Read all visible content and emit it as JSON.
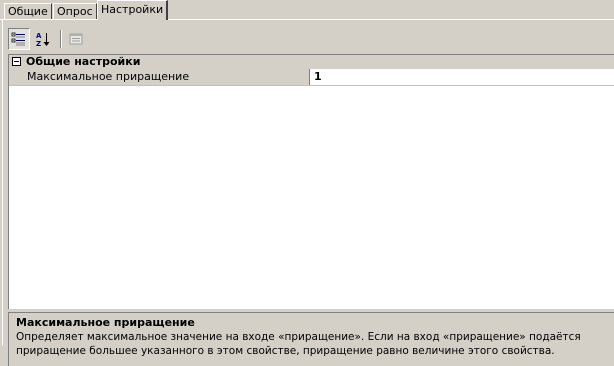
{
  "tabs": [
    {
      "label": "Общие",
      "active": false
    },
    {
      "label": "Опрос",
      "active": false
    },
    {
      "label": "Настройки",
      "active": true
    }
  ],
  "toolbar": {
    "buttons": [
      {
        "icon": "categorized-view-icon",
        "pressed": true
      },
      {
        "icon": "sort-alphabetical-icon",
        "pressed": false
      },
      {
        "icon": "property-pages-icon",
        "pressed": false,
        "disabled": true
      }
    ]
  },
  "grid": {
    "category": {
      "label": "Общие настройки",
      "expanded": true
    },
    "properties": [
      {
        "name": "Максимальное приращение",
        "value": "1"
      }
    ]
  },
  "description": {
    "title": "Максимальное приращение",
    "text": "Определяет максимальное значение на входе «приращение». Если на вход «приращение» подаётся приращение большее указанного в этом свойстве, приращение равно величине этого свойства."
  }
}
